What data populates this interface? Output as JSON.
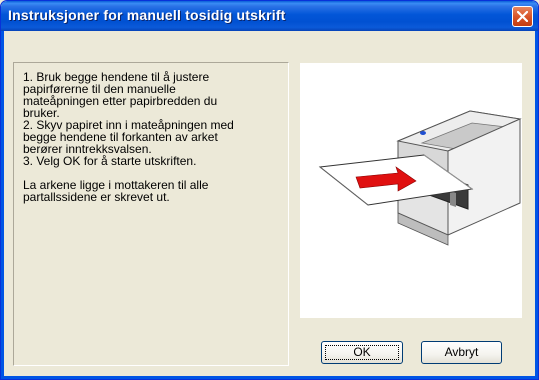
{
  "window": {
    "title": "Instruksjoner for manuell tosidig utskrift"
  },
  "instructions": {
    "text": "1. Bruk begge hendene til å justere\npapirførerne til den manuelle\nmateåpningen etter papirbredden du\nbruker.\n2. Skyv papiret inn i mateåpningen med\nbegge hendene til forkanten av arket\nberører inntrekksvalsen.\n3. Velg OK for å starte utskriften.\n\nLa arkene ligge i mottakeren til alle\npartallssidene er skrevet ut."
  },
  "buttons": {
    "ok": "OK",
    "cancel": "Avbryt"
  },
  "icons": {
    "close": "close-icon",
    "illustration": "printer-manual-feed-illustration"
  },
  "colors": {
    "titlebar": "#0054E3",
    "close_button": "#D9552A",
    "dialog_background": "#ECE9D8"
  }
}
